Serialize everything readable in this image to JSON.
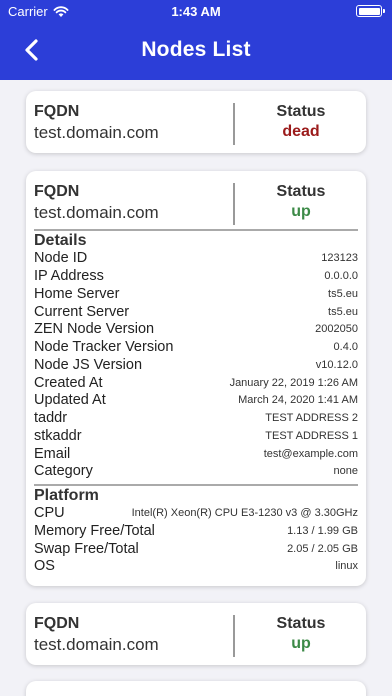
{
  "status_bar": {
    "carrier": "Carrier",
    "time": "1:43 AM"
  },
  "nav": {
    "title": "Nodes List"
  },
  "labels": {
    "fqdn": "FQDN",
    "status": "Status",
    "details": "Details",
    "platform": "Platform",
    "node_id": "Node ID",
    "ip_address": "IP Address",
    "home_server": "Home Server",
    "current_server": "Current Server",
    "zen_node_version": "ZEN Node Version",
    "node_tracker_version": "Node Tracker Version",
    "node_js_version": "Node JS Version",
    "created_at": "Created At",
    "updated_at": "Updated At",
    "taddr": "taddr",
    "stkaddr": "stkaddr",
    "email": "Email",
    "category": "Category",
    "cpu": "CPU",
    "memory": "Memory Free/Total",
    "swap": "Swap Free/Total",
    "os": "OS"
  },
  "nodes": [
    {
      "fqdn": "test.domain.com",
      "status": "dead"
    },
    {
      "fqdn": "test.domain.com",
      "status": "up",
      "details": {
        "node_id": "123123",
        "ip_address": "0.0.0.0",
        "home_server": "ts5.eu",
        "current_server": "ts5.eu",
        "zen_node_version": "2002050",
        "node_tracker_version": "0.4.0",
        "node_js_version": "v10.12.0",
        "created_at": "January 22, 2019 1:26 AM",
        "updated_at": "March 24, 2020 1:41 AM",
        "taddr": "TEST ADDRESS 2",
        "stkaddr": "TEST ADDRESS 1",
        "email": "test@example.com",
        "category": "none"
      },
      "platform": {
        "cpu": "Intel(R) Xeon(R) CPU E3-1230 v3 @ 3.30GHz",
        "memory": "1.13 / 1.99 GB",
        "swap": "2.05 / 2.05 GB",
        "os": "linux"
      }
    },
    {
      "fqdn": "test.domain.com",
      "status": "up"
    }
  ],
  "colors": {
    "nav_bg": "#2c3ed8",
    "status_dead": "#9b1b1b",
    "status_up": "#3c8a47",
    "page_bg": "#f2f2f7"
  }
}
